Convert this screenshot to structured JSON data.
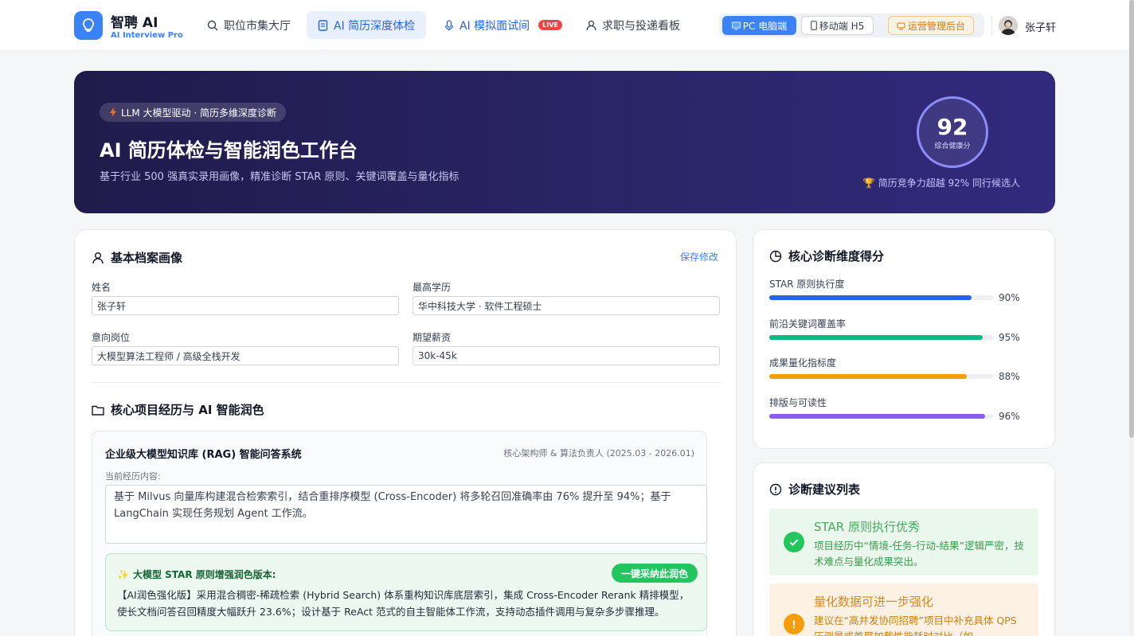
{
  "app": {
    "name": "智聘 AI",
    "subtitle": "AI Interview Pro"
  },
  "nav": {
    "items": [
      {
        "label": "职位市集大厅",
        "icon": "search-icon"
      },
      {
        "label": "AI 简历深度体检",
        "icon": "document-icon",
        "active": true
      },
      {
        "label": "AI 模拟面试间",
        "icon": "mic-icon",
        "badge": "LIVE"
      },
      {
        "label": "求职与投递看板",
        "icon": "user-icon"
      }
    ]
  },
  "modes": {
    "pc": "PC 电脑端",
    "mobile": "移动端 H5",
    "admin": "运营管理后台"
  },
  "user": {
    "name": "张子轩"
  },
  "hero": {
    "badge": "LLM 大模型驱动 · 简历多维深度诊断",
    "title": "AI 简历体检与智能润色工作台",
    "desc": "基于行业 500 强真实录用画像，精准诊断 STAR 原则、关键词覆盖与量化指标",
    "score": "92",
    "score_label": "综合健康分",
    "rank": "简历竞争力超越 92% 同行候选人"
  },
  "profile": {
    "title": "基本档案画像",
    "save": "保存修改",
    "fields": {
      "name_label": "姓名",
      "name": "张子轩",
      "edu_label": "最高学历",
      "edu": "华中科技大学 · 软件工程硕士",
      "job_label": "意向岗位",
      "job": "大模型算法工程师 / 高级全栈开发",
      "salary_label": "期望薪资",
      "salary": "30k-45k"
    }
  },
  "projects": {
    "title": "核心项目经历与 AI 智能润色",
    "item": {
      "name": "企业级大模型知识库 (RAG) 智能问答系统",
      "role": "核心架构师 & 算法负责人 (2025.03 - 2026.01)",
      "current_label": "当前经历内容:",
      "current": "基于 Milvus 向量库构建混合检索索引，结合重排序模型 (Cross-Encoder) 将多轮召回准确率由 76% 提升至 94%；基于 LangChain 实现任务规划 Agent 工作流。",
      "polish_title": "大模型 STAR 原则增强润色版本:",
      "adopt": "一键采纳此润色",
      "polish_text": "【AI润色强化版】采用混合稠密-稀疏检索 (Hybrid Search) 体系重构知识库底层索引，集成 Cross-Encoder Rerank 精排模型，使长文档问答召回精度大幅跃升 23.6%；设计基于 ReAct 范式的自主智能体工作流，支持动态插件调用与复杂多步骤推理。"
    }
  },
  "scores": {
    "title": "核心诊断维度得分",
    "items": [
      {
        "label": "STAR 原则执行度",
        "value": 90,
        "display": "90%",
        "color": "#2563eb"
      },
      {
        "label": "前沿关键词覆盖率",
        "value": 95,
        "display": "95%",
        "color": "#10b981"
      },
      {
        "label": "成果量化指标度",
        "value": 88,
        "display": "88%",
        "color": "#f59e0b"
      },
      {
        "label": "排版与可读性",
        "value": 96,
        "display": "96%",
        "color": "#8b5cf6"
      }
    ]
  },
  "suggestions": {
    "title": "诊断建议列表",
    "items": [
      {
        "title": "STAR 原则执行优秀",
        "text": "项目经历中“情境-任务-行动-结果”逻辑严密，技术难点与量化成果突出。",
        "type": "good"
      },
      {
        "title": "量化数据可进一步强化",
        "text": "建议在“高并发协同招聘”项目中补充具体 QPS 压测量或首屏加载性能耗时对比（如",
        "type": "warn"
      }
    ]
  },
  "colors": {
    "primary": "#3b82f6",
    "success": "#22c55e",
    "warning": "#f59e0b",
    "hero_bg": "#1f1b4b"
  }
}
